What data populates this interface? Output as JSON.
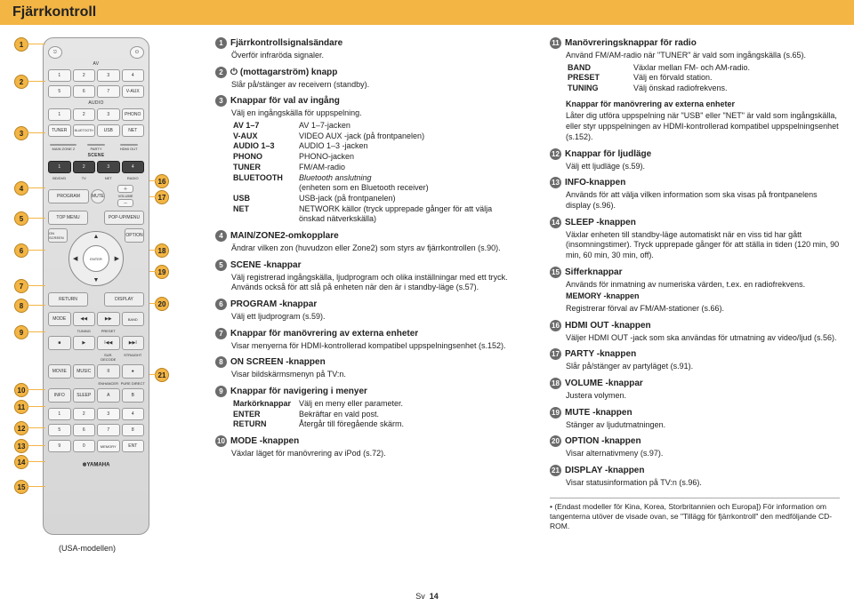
{
  "title": "Fjärrkontroll",
  "page_label": "Sv",
  "page_number": "14",
  "usa_note": "(USA-modellen)",
  "items": {
    "1": {
      "head": "Fjärrkontrollsignalsändare",
      "desc": "Överför infraröda signaler."
    },
    "2": {
      "head": " (mottagarström) knapp",
      "desc": "Slår på/stänger av receivern (standby)."
    },
    "3": {
      "head": "Knappar för val av ingång",
      "desc": "Välj en ingångskälla för uppspelning."
    },
    "3_tbl": {
      "av": [
        "AV 1–7",
        "AV 1–7-jacken"
      ],
      "vaux": [
        "V-AUX",
        "VIDEO AUX -jack (på frontpanelen)"
      ],
      "audio": [
        "AUDIO 1–3",
        "AUDIO 1–3 -jacken"
      ],
      "phono": [
        "PHONO",
        "PHONO-jacken"
      ],
      "tuner": [
        "TUNER",
        "FM/AM-radio"
      ],
      "bt1": [
        "BLUETOOTH",
        "Bluetooth anslutning"
      ],
      "bt2": [
        "",
        "(enheten som en Bluetooth receiver)"
      ],
      "usb": [
        "USB",
        "USB-jack (på frontpanelen)"
      ],
      "net1": [
        "NET",
        "NETWORK källor (tryck upprepade gånger för att välja"
      ],
      "net2": [
        "",
        "önskad nätverkskälla)"
      ]
    },
    "4": {
      "head": "MAIN/ZONE2-omkopplare",
      "desc": "Ändrar vilken zon (huvudzon eller Zone2) som styrs av fjärrkontrollen (s.90)."
    },
    "5": {
      "head": "SCENE -knappar",
      "desc": "Välj registrerad ingångskälla, ljudprogram och olika inställningar med ett tryck. Används också för att slå på enheten när den är i standby-läge (s.57)."
    },
    "6": {
      "head": "PROGRAM -knappar",
      "desc": "Välj ett ljudprogram (s.59)."
    },
    "7": {
      "head": "Knappar för manövrering av externa enheter",
      "desc": "Visar menyerna för HDMI-kontrollerad kompatibel uppspelningsenhet (s.152)."
    },
    "8": {
      "head": "ON SCREEN -knappen",
      "desc": "Visar bildskärmsmenyn på TV:n."
    },
    "9": {
      "head": "Knappar för navigering i menyer"
    },
    "9_tbl": {
      "cur": [
        "Markörknappar",
        "Välj en meny eller parameter."
      ],
      "enter": [
        "ENTER",
        "Bekräftar en vald post."
      ],
      "ret": [
        "RETURN",
        "Återgår till föregående skärm."
      ]
    },
    "10": {
      "head": "MODE -knappen",
      "desc": "Växlar läget för manövrering av iPod (s.72)."
    },
    "11": {
      "head": "Manövreringsknappar för radio",
      "desc": "Använd FM/AM-radio när \"TUNER\" är vald som ingångskälla (s.65)."
    },
    "11_tbl": {
      "band": [
        "BAND",
        "Växlar mellan FM- och AM-radio."
      ],
      "preset": [
        "PRESET",
        "Välj en förvald station."
      ],
      "tuning": [
        "TUNING",
        "Välj önskad radiofrekvens."
      ]
    },
    "11b_head": "Knappar för manövrering av externa enheter",
    "11b_desc": "Låter dig utföra uppspelning när \"USB\" eller \"NET\" är vald som ingångskälla, eller styr uppspelningen av HDMI-kontrollerad kompatibel uppspelningsenhet (s.152).",
    "12": {
      "head": "Knappar för ljudläge",
      "desc": "Välj ett ljudläge (s.59)."
    },
    "13": {
      "head": "INFO-knappen",
      "desc": "Används för att välja vilken information som ska visas på frontpanelens display (s.96)."
    },
    "14": {
      "head": "SLEEP -knappen",
      "desc": "Växlar enheten till standby-läge automatiskt när en viss tid har gått (insomningstimer). Tryck upprepade gånger för att ställa in tiden (120 min, 90 min, 60 min, 30 min, off)."
    },
    "15": {
      "head": "Sifferknappar",
      "desc": "Används för inmatning av numeriska värden, t.ex. en radiofrekvens."
    },
    "15b_head": "MEMORY -knappen",
    "15b_desc": "Registrerar förval av FM/AM-stationer (s.66).",
    "16": {
      "head": "HDMI OUT -knappen",
      "desc": "Väljer HDMI OUT -jack som ska användas för utmatning av video/ljud (s.56)."
    },
    "17": {
      "head": "PARTY -knappen",
      "desc": "Slår på/stänger av partyläget (s.91)."
    },
    "18": {
      "head": "VOLUME -knappar",
      "desc": "Justera volymen."
    },
    "19": {
      "head": "MUTE -knappen",
      "desc": "Stänger av ljudutmatningen."
    },
    "20": {
      "head": "OPTION -knappen",
      "desc": "Visar alternativmeny (s.97)."
    },
    "21": {
      "head": "DISPLAY -knappen",
      "desc": "Visar statusinformation på TV:n (s.96)."
    }
  },
  "note": "• (Endast modeller för Kina, Korea, Storbritannien och Europa])\nFör information om tangenterna utöver de visade ovan, se \"Tillägg för fjärrkontroll\" den medföljande CD-ROM.",
  "remote": {
    "av": "AV",
    "audio": "AUDIO",
    "vaux": "V-AUX",
    "phono": "PHONO",
    "tuner": "TUNER",
    "bt": "BLUETOOTH",
    "usb": "USB",
    "net": "NET",
    "main": "MAIN",
    "zone2": "ZONE 2",
    "party": "PARTY",
    "hdmiout": "HDMI OUT",
    "scene": "SCENE",
    "bddvd": "BD/DVD",
    "tv": "TV",
    "s_net": "NET",
    "radio": "RADIO",
    "program": "PROGRAM",
    "mute": "MUTE",
    "volume": "VOLUME",
    "topmenu": "TOP MENU",
    "popup": "POP-UP/MENU",
    "onscreen": "ON SCREEN",
    "option": "OPTION",
    "enter": "ENTER",
    "return": "RETURN",
    "display": "DISPLAY",
    "mode": "MODE",
    "band": "BAND",
    "tuning": "TUNING",
    "preset": "PRESET",
    "movie": "MOVIE",
    "music": "MUSIC",
    "surdecode": "SUR. DECODE",
    "straight": "STRAIGHT",
    "info": "INFO",
    "sleep": "SLEEP",
    "enhancer": "ENHANCER",
    "puredirect": "PURE DIRECT",
    "memory": "MEMORY",
    "ent": "ENT"
  }
}
